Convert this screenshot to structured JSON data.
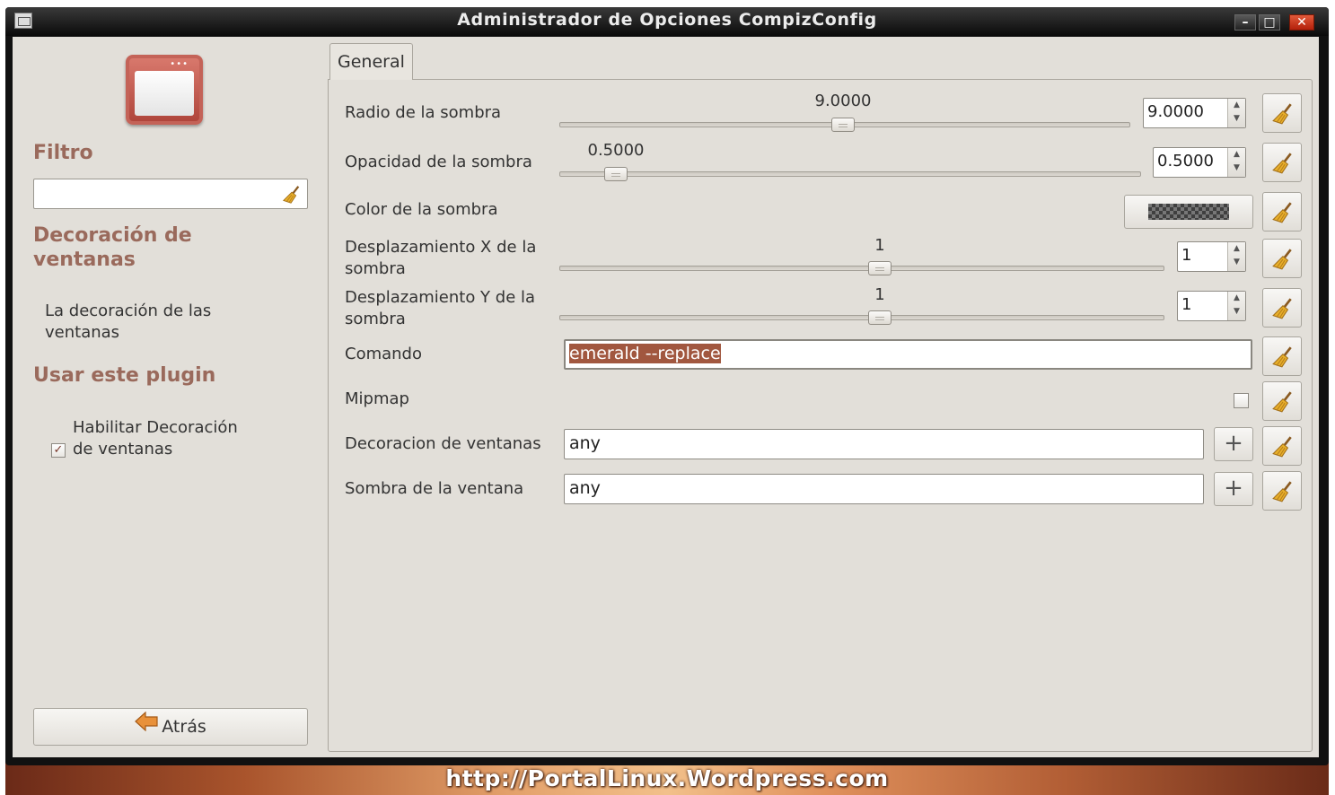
{
  "window": {
    "title": "Administrador de Opciones CompizConfig",
    "controls": {
      "minimize": "–",
      "maximize": "□",
      "close": "✕"
    }
  },
  "sidebar": {
    "filter_heading": "Filtro",
    "filter_value": "",
    "plugin_heading": "Decoración de ventanas",
    "plugin_description": "La decoración de las ventanas",
    "use_plugin_heading": "Usar este plugin",
    "enable_label": "Habilitar Decoración de ventanas",
    "enable_checked": true,
    "enable_checkmark": "✓",
    "back_label": "Atrás"
  },
  "tabs": [
    {
      "label": "General",
      "active": true
    }
  ],
  "settings": {
    "shadow_radius": {
      "label": "Radio de la sombra",
      "value": "9.0000",
      "slider_fraction": 0.5
    },
    "shadow_opacity": {
      "label": "Opacidad de la sombra",
      "value": "0.5000",
      "slider_fraction": 0.1
    },
    "shadow_color": {
      "label": "Color de la sombra"
    },
    "shadow_x_offset": {
      "label": "Desplazamiento X de la sombra",
      "value": "1",
      "slider_fraction": 0.53
    },
    "shadow_y_offset": {
      "label": "Desplazamiento Y de la sombra",
      "value": "1",
      "slider_fraction": 0.53
    },
    "command": {
      "label": "Comando",
      "value": "emerald --replace"
    },
    "mipmap": {
      "label": "Mipmap",
      "checked": false
    },
    "decoration_windows": {
      "label": "Decoracion de ventanas",
      "value": "any"
    },
    "window_shadow": {
      "label": "Sombra de la ventana",
      "value": "any"
    }
  },
  "icons": {
    "reset": "broom-icon",
    "add": "plus-icon",
    "back": "arrow-left-icon",
    "spin_up": "▲",
    "spin_down": "▼",
    "plus_glyph": "+"
  },
  "watermark": "http://PortalLinux.Wordpress.com",
  "colors": {
    "accent_heading": "#9a6a5c",
    "selection": "#a1573f",
    "background": "#e2dfd9"
  }
}
